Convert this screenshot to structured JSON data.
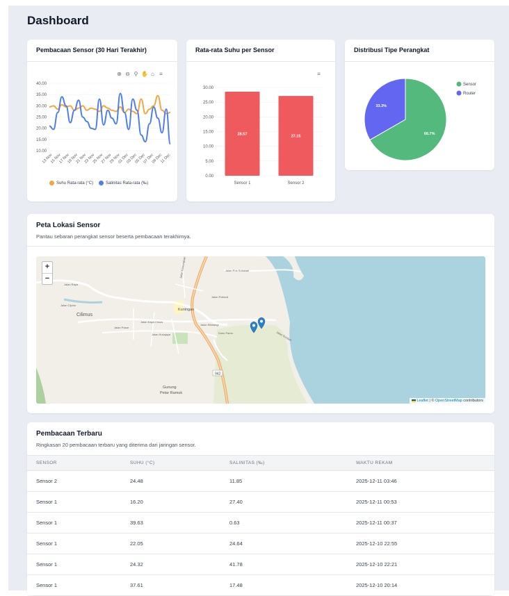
{
  "page": {
    "title": "Dashboard"
  },
  "charts": {
    "line": {
      "title": "Pembacaan Sensor (30 Hari Terakhir)",
      "toolbar_icons": [
        "zoom-in-icon",
        "zoom-out-icon",
        "zoom-select-icon",
        "pan-hand-icon",
        "home-icon",
        "menu-icon"
      ]
    },
    "bar": {
      "title": "Rata-rata Suhu per Sensor",
      "toolbar_icons": [
        "menu-icon"
      ]
    },
    "pie": {
      "title": "Distribusi Tipe Perangkat"
    }
  },
  "chart_data": [
    {
      "type": "line",
      "ylim": [
        10,
        40
      ],
      "yticks": [
        "40.00",
        "35.00",
        "30.00",
        "25.00",
        "20.00",
        "15.00",
        "10.00"
      ],
      "x_tick_labels": [
        "13 Nov",
        "15 Nov",
        "17 Nov",
        "19 Nov",
        "21 Nov",
        "23 Nov",
        "25 Nov",
        "27 Nov",
        "29 Nov",
        "01 Dec",
        "03 Dec",
        "05 Dec",
        "07 Dec",
        "09 Dec",
        "11 Dec"
      ],
      "series": [
        {
          "name": "Suhu Rata-rata (°C)",
          "color": "#f2a541",
          "values": [
            29.5,
            30,
            28.5,
            30.5,
            29.5,
            30,
            28,
            29,
            30,
            28,
            29,
            28.5,
            27.5,
            30,
            29,
            28,
            27.5,
            29.5,
            27,
            28.5,
            27.5,
            26.5,
            33,
            26.5,
            28.5,
            30,
            34.5,
            28,
            26.5,
            27
          ]
        },
        {
          "name": "Salinitas Rata-rata (‰)",
          "color": "#4e7ee8",
          "values": [
            21,
            19.5,
            27,
            34,
            30,
            22.5,
            28,
            32.5,
            25,
            23,
            20,
            19.5,
            33,
            21.5,
            28,
            24.5,
            22,
            35.5,
            27,
            19.5,
            33,
            28,
            17,
            14,
            22,
            29.5,
            24.5,
            18,
            28.5,
            13
          ]
        }
      ]
    },
    {
      "type": "bar",
      "ylim": [
        0,
        30
      ],
      "yticks": [
        "30.00",
        "25.00",
        "20.00",
        "15.00",
        "10.00",
        "5.00",
        "0.00"
      ],
      "categories": [
        "Sensor 1",
        "Sensor 2"
      ],
      "values": [
        28.57,
        27.15
      ],
      "data_labels": [
        "28.57",
        "27.15"
      ],
      "color": "#ef5a5f"
    },
    {
      "type": "pie",
      "slices": [
        {
          "name": "Sensor",
          "value": 66.7,
          "label": "66.7%",
          "color": "#53b97c"
        },
        {
          "name": "Router",
          "value": 33.3,
          "label": "33.3%",
          "color": "#6366f1"
        }
      ]
    }
  ],
  "map_section": {
    "title": "Peta Lokasi Sensor",
    "subtitle": "Pantau sebaran perangkat sensor beserta pembacaan terakhirnya.",
    "zoom_in": "+",
    "zoom_out": "−",
    "labels": {
      "cilimus": "Cilimus",
      "kuningan": "Kuningan",
      "gunung": "Gunung",
      "petar": "Petar Ramuk",
      "road": "942",
      "jalan_raya": "Jalan Raya",
      "jalan_kaya": "Jalan Kaya Cimus",
      "jalan_pasar": "Jalan Pasar",
      "jalan_sukajaya": "Jalan Sukajaya",
      "jalan_patrouli": "Jalan Patrouli",
      "jalan_siliwangi": "Jalan Siliwangi",
      "jalan_cijoho": "Jalan Cijoho",
      "jalan_pos": "Jalan Pos Sukasari",
      "jalan_kaw": "Jalan Kawungsari",
      "dukupamu": "Duku Pamu",
      "kec_tembok": "Jalan Tembok"
    },
    "attribution": {
      "leaflet": "Leaflet",
      "sep": " | © ",
      "osm": "OpenStreetMap",
      "rest": " contributors"
    }
  },
  "readings": {
    "title": "Pembacaan Terbaru",
    "subtitle": "Ringkasan 20 pembacaan terbaru yang diterima dari jaringan sensor.",
    "columns": [
      "SENSOR",
      "SUHU (°C)",
      "SALINITAS (‰)",
      "WAKTU REKAM"
    ],
    "rows": [
      [
        "Sensor 2",
        "24.48",
        "11.85",
        "2025-12-11 03:46"
      ],
      [
        "Sensor 1",
        "16.20",
        "27.40",
        "2025-12-11 00:53"
      ],
      [
        "Sensor 1",
        "39.63",
        "0.63",
        "2025-12-11 00:37"
      ],
      [
        "Sensor 1",
        "22.05",
        "24.64",
        "2025-12-10 22:55"
      ],
      [
        "Sensor 1",
        "24.32",
        "41.78",
        "2025-12-10 22:21"
      ],
      [
        "Sensor 1",
        "37.61",
        "17.48",
        "2025-12-10 20:14"
      ]
    ]
  }
}
